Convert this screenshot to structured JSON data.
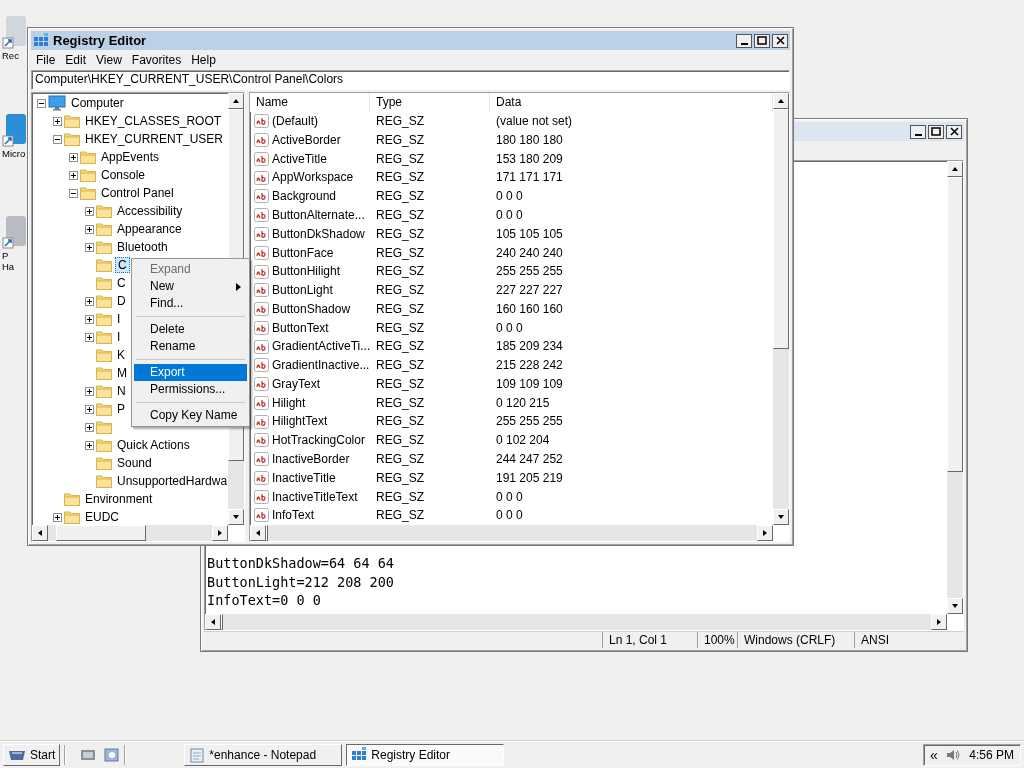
{
  "desktop_icons": [
    {
      "lines": [
        "Rec"
      ]
    },
    {
      "lines": [
        "Micro"
      ]
    },
    {
      "lines": [
        "P",
        "Ha"
      ]
    }
  ],
  "notepad": {
    "lines": [
      "ButtonDkShadow=64 64 64",
      "ButtonLight=212 208 200",
      "InfoText=0 0 0"
    ],
    "status": [
      "Ln 1, Col 1",
      "100%",
      "Windows (CRLF)",
      "ANSI"
    ]
  },
  "regedit": {
    "title": "Registry Editor",
    "menu": [
      "File",
      "Edit",
      "View",
      "Favorites",
      "Help"
    ],
    "address": "Computer\\HKEY_CURRENT_USER\\Control Panel\\Colors",
    "tree": [
      {
        "label": "Computer",
        "expandable": true,
        "expanded": true,
        "selected": false,
        "children": [
          {
            "label": "HKEY_CLASSES_ROOT",
            "expandable": true,
            "expanded": false,
            "selected": false
          },
          {
            "label": "HKEY_CURRENT_USER",
            "expandable": true,
            "expanded": true,
            "selected": false,
            "children": [
              {
                "label": "AppEvents",
                "expandable": true,
                "expanded": false,
                "selected": false
              },
              {
                "label": "Console",
                "expandable": true,
                "expanded": false,
                "selected": false
              },
              {
                "label": "Control Panel",
                "expandable": true,
                "expanded": true,
                "selected": false,
                "children": [
                  {
                    "label": "Accessibility",
                    "expandable": true,
                    "expanded": false,
                    "selected": false
                  },
                  {
                    "label": "Appearance",
                    "expandable": true,
                    "expanded": false,
                    "selected": false
                  },
                  {
                    "label": "Bluetooth",
                    "expandable": true,
                    "expanded": false,
                    "selected": false
                  },
                  {
                    "label": "C",
                    "expandable": false,
                    "selected": true
                  },
                  {
                    "label": "C",
                    "expandable": false,
                    "selected": false
                  },
                  {
                    "label": "D",
                    "expandable": true,
                    "expanded": false,
                    "selected": false
                  },
                  {
                    "label": "I",
                    "expandable": true,
                    "expanded": false,
                    "selected": false
                  },
                  {
                    "label": "I",
                    "expandable": true,
                    "expanded": false,
                    "selected": false
                  },
                  {
                    "label": "K",
                    "expandable": false,
                    "selected": false
                  },
                  {
                    "label": "M",
                    "expandable": false,
                    "selected": false
                  },
                  {
                    "label": "N",
                    "expandable": true,
                    "expanded": false,
                    "selected": false
                  },
                  {
                    "label": "P",
                    "expandable": true,
                    "expanded": false,
                    "selected": false
                  },
                  {
                    "expandable": true,
                    "expanded": false,
                    "selected": false
                  },
                  {
                    "label": "Quick Actions",
                    "expandable": true,
                    "expanded": false,
                    "selected": false
                  },
                  {
                    "label": "Sound",
                    "expandable": false,
                    "selected": false
                  },
                  {
                    "label": "UnsupportedHardwa",
                    "expandable": false,
                    "selected": false
                  }
                ]
              }
            ]
          },
          {
            "label": "Environment",
            "expandable": false,
            "selected": false
          },
          {
            "label": "EUDC",
            "expandable": true,
            "expanded": false,
            "selected": false
          }
        ]
      }
    ],
    "columns": [
      "Name",
      "Type",
      "Data"
    ],
    "values": [
      {
        "name": "(Default)",
        "type": "REG_SZ",
        "data": "(value not set)"
      },
      {
        "name": "ActiveBorder",
        "type": "REG_SZ",
        "data": "180 180 180"
      },
      {
        "name": "ActiveTitle",
        "type": "REG_SZ",
        "data": "153 180 209"
      },
      {
        "name": "AppWorkspace",
        "type": "REG_SZ",
        "data": "171 171 171"
      },
      {
        "name": "Background",
        "type": "REG_SZ",
        "data": "0 0 0"
      },
      {
        "name": "ButtonAlternate...",
        "type": "REG_SZ",
        "data": "0 0 0"
      },
      {
        "name": "ButtonDkShadow",
        "type": "REG_SZ",
        "data": "105 105 105"
      },
      {
        "name": "ButtonFace",
        "type": "REG_SZ",
        "data": "240 240 240"
      },
      {
        "name": "ButtonHilight",
        "type": "REG_SZ",
        "data": "255 255 255"
      },
      {
        "name": "ButtonLight",
        "type": "REG_SZ",
        "data": "227 227 227"
      },
      {
        "name": "ButtonShadow",
        "type": "REG_SZ",
        "data": "160 160 160"
      },
      {
        "name": "ButtonText",
        "type": "REG_SZ",
        "data": "0 0 0"
      },
      {
        "name": "GradientActiveTi...",
        "type": "REG_SZ",
        "data": "185 209 234"
      },
      {
        "name": "GradientInactive...",
        "type": "REG_SZ",
        "data": "215 228 242"
      },
      {
        "name": "GrayText",
        "type": "REG_SZ",
        "data": "109 109 109"
      },
      {
        "name": "Hilight",
        "type": "REG_SZ",
        "data": "0 120 215"
      },
      {
        "name": "HilightText",
        "type": "REG_SZ",
        "data": "255 255 255"
      },
      {
        "name": "HotTrackingColor",
        "type": "REG_SZ",
        "data": "0 102 204"
      },
      {
        "name": "InactiveBorder",
        "type": "REG_SZ",
        "data": "244 247 252"
      },
      {
        "name": "InactiveTitle",
        "type": "REG_SZ",
        "data": "191 205 219"
      },
      {
        "name": "InactiveTitleText",
        "type": "REG_SZ",
        "data": "0 0 0"
      },
      {
        "name": "InfoText",
        "type": "REG_SZ",
        "data": "0 0 0"
      }
    ]
  },
  "context_menu": [
    {
      "kind": "item",
      "label": "Expand",
      "disabled": true,
      "submenu": false,
      "selected": false
    },
    {
      "kind": "item",
      "label": "New",
      "disabled": false,
      "submenu": true,
      "selected": false
    },
    {
      "kind": "item",
      "label": "Find...",
      "disabled": false,
      "submenu": false,
      "selected": false
    },
    {
      "kind": "separator"
    },
    {
      "kind": "item",
      "label": "Delete",
      "disabled": false,
      "submenu": false,
      "selected": false
    },
    {
      "kind": "item",
      "label": "Rename",
      "disabled": false,
      "submenu": false,
      "selected": false
    },
    {
      "kind": "separator"
    },
    {
      "kind": "item",
      "label": "Export",
      "disabled": false,
      "submenu": false,
      "selected": true
    },
    {
      "kind": "item",
      "label": "Permissions...",
      "disabled": false,
      "submenu": false,
      "selected": false
    },
    {
      "kind": "separator"
    },
    {
      "kind": "item",
      "label": "Copy Key Name",
      "disabled": false,
      "submenu": false,
      "selected": false
    }
  ],
  "taskbar": {
    "start": "Start",
    "tasks": [
      {
        "label": "*enhance - Notepad",
        "kind": "notepad",
        "selected": false
      },
      {
        "label": "Registry Editor",
        "kind": "regedit",
        "selected": true
      }
    ],
    "tray_arrow": "«",
    "clock": "4:56 PM"
  }
}
